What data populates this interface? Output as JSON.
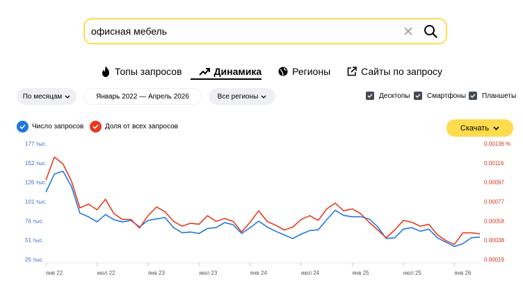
{
  "search": {
    "query": "офисная мебель"
  },
  "tabs": [
    {
      "label": "Топы запросов",
      "icon": "fire-icon"
    },
    {
      "label": "Динамика",
      "icon": "trend-icon",
      "active": true
    },
    {
      "label": "Регионы",
      "icon": "globe-icon"
    },
    {
      "label": "Сайты по запросу",
      "icon": "external-link-icon"
    }
  ],
  "filters": {
    "granularity": "По месяцам",
    "period": "Январь 2022 — Апрель 2026",
    "regions": "Все регионы"
  },
  "devices": [
    {
      "label": "Десктопы",
      "checked": true
    },
    {
      "label": "Смартфоны",
      "checked": true
    },
    {
      "label": "Планшеты",
      "checked": true
    }
  ],
  "legend": {
    "count_label": "Число запросов",
    "share_label": "Доля от всех запросов"
  },
  "download_label": "Скачать",
  "colors": {
    "accent": "#ffdb4d",
    "count": "#1f77e0",
    "share": "#e8391d"
  },
  "chart_data": {
    "type": "line",
    "y_left_ticks": [
      "177 тыс.",
      "152 тыс.",
      "126 тыс.",
      "101 тыс.",
      "76 тыс.",
      "51 тыс.",
      "25 тыс."
    ],
    "y_right_ticks": [
      "0.00136 %",
      "0.00116",
      "0.00097",
      "0.00077",
      "0.00058",
      "0.00038",
      "0.00019"
    ],
    "x_ticks": [
      "янв 22",
      "июл 22",
      "янв 23",
      "июл 23",
      "янв 24",
      "июл 24",
      "янв 25",
      "июл 25",
      "янв 26"
    ],
    "x": [
      "2022-01",
      "2022-02",
      "2022-03",
      "2022-04",
      "2022-05",
      "2022-06",
      "2022-07",
      "2022-08",
      "2022-09",
      "2022-10",
      "2022-11",
      "2022-12",
      "2023-01",
      "2023-02",
      "2023-03",
      "2023-04",
      "2023-05",
      "2023-06",
      "2023-07",
      "2023-08",
      "2023-09",
      "2023-10",
      "2023-11",
      "2023-12",
      "2024-01",
      "2024-02",
      "2024-03",
      "2024-04",
      "2024-05",
      "2024-06",
      "2024-07",
      "2024-08",
      "2024-09",
      "2024-10",
      "2024-11",
      "2024-12",
      "2025-01",
      "2025-02",
      "2025-03",
      "2025-04",
      "2025-05",
      "2025-06",
      "2025-07",
      "2025-08",
      "2025-09",
      "2025-10",
      "2025-11",
      "2025-12",
      "2026-01",
      "2026-02",
      "2026-03",
      "2026-04"
    ],
    "series": [
      {
        "name": "Число запросов",
        "axis": "left",
        "values": [
          110,
          135,
          139,
          118,
          81,
          76,
          69,
          79,
          72,
          69,
          71,
          62,
          71,
          73,
          75,
          61,
          54,
          55,
          53,
          60,
          61,
          68,
          65,
          53,
          61,
          70,
          62,
          56,
          51,
          46,
          52,
          57,
          58,
          72,
          85,
          78,
          76,
          76,
          73,
          62,
          46,
          47,
          59,
          61,
          56,
          59,
          47,
          41,
          35,
          39,
          47,
          48
        ]
      },
      {
        "name": "Доля от всех запросов",
        "axis": "right",
        "values": [
          0.00098,
          0.00122,
          0.00115,
          0.00097,
          0.00069,
          0.00073,
          0.00067,
          0.00078,
          0.00063,
          0.00057,
          0.00057,
          0.00048,
          0.00061,
          0.0007,
          0.00065,
          0.00055,
          0.0005,
          0.00053,
          0.00052,
          0.00061,
          0.00055,
          0.00058,
          0.00055,
          0.00044,
          0.00054,
          0.00066,
          0.00055,
          0.00051,
          0.00046,
          0.00049,
          0.00057,
          0.00061,
          0.00056,
          0.00068,
          0.00074,
          0.00066,
          0.00068,
          0.00063,
          0.00054,
          0.00046,
          0.00038,
          0.00046,
          0.00056,
          0.00054,
          0.0005,
          0.00052,
          0.00041,
          0.00035,
          0.00031,
          0.00043,
          0.00043,
          0.00042
        ]
      }
    ],
    "ylim_left": [
      18,
      177
    ],
    "ylim_right": [
      0.00016,
      0.00136
    ],
    "grid": false,
    "legend": "top-left"
  }
}
